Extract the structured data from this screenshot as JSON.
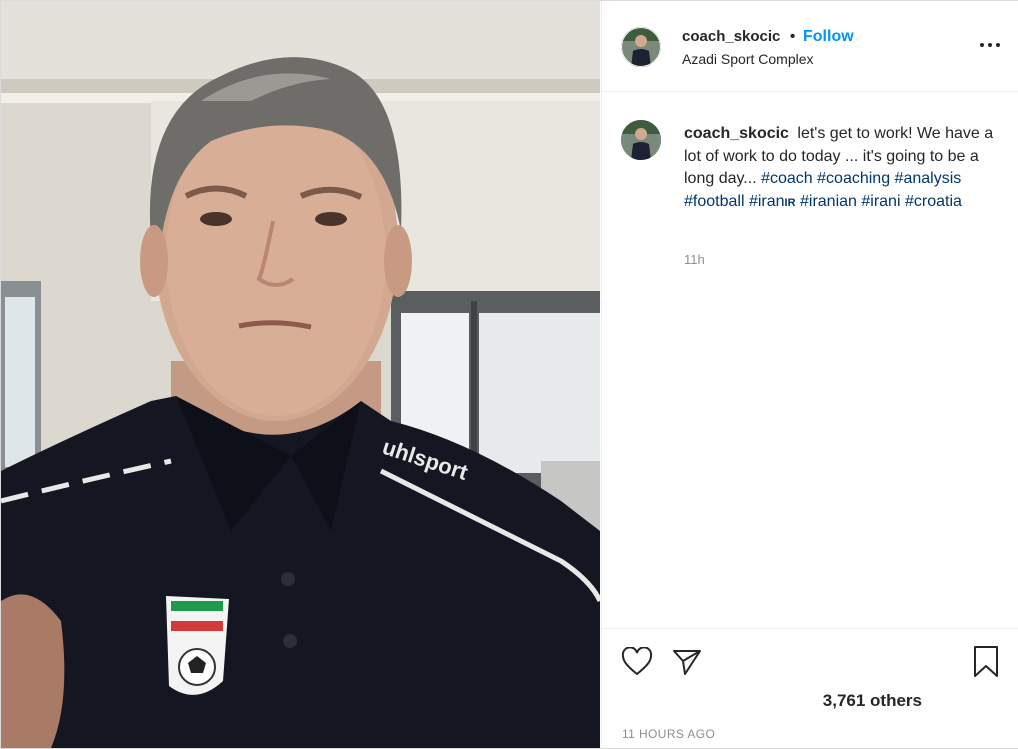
{
  "post": {
    "username": "coach_skocic",
    "dot": "•",
    "follow_label": "Follow",
    "location": "Azadi Sport Complex",
    "more_icon": "more-options-icon",
    "caption": {
      "username": "coach_skocic",
      "text": "let's get to work! We have a lot of work to do today ... it's going to be a long day...",
      "hashtags": [
        "#coach",
        "#coaching",
        "#analysis",
        "#football",
        "#iran",
        "#iranian",
        "#irani",
        "#croatia"
      ],
      "flag_code": "IR"
    },
    "time_relative": "11h",
    "likes_text": "3,761 others",
    "time_ago": "11 HOURS AGO"
  },
  "actions": {
    "like_icon": "heart-icon",
    "share_icon": "paper-plane-icon",
    "save_icon": "bookmark-icon"
  },
  "photo": {
    "shirt_text": "uhlsport"
  },
  "colors": {
    "link": "#0095f6",
    "hashtag": "#00376b",
    "muted": "#8e8e8e",
    "text": "#262626",
    "border": "#dbdbdb"
  }
}
